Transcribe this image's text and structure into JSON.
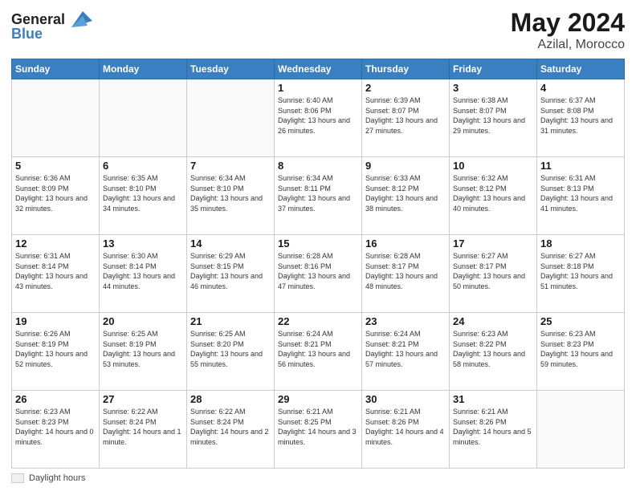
{
  "logo": {
    "part1": "General",
    "part2": "Blue"
  },
  "calendar": {
    "title": "May 2024",
    "subtitle": "Azilal, Morocco",
    "days_of_week": [
      "Sunday",
      "Monday",
      "Tuesday",
      "Wednesday",
      "Thursday",
      "Friday",
      "Saturday"
    ],
    "weeks": [
      [
        {
          "day": "",
          "info": ""
        },
        {
          "day": "",
          "info": ""
        },
        {
          "day": "",
          "info": ""
        },
        {
          "day": "1",
          "info": "Sunrise: 6:40 AM\nSunset: 8:06 PM\nDaylight: 13 hours and 26 minutes."
        },
        {
          "day": "2",
          "info": "Sunrise: 6:39 AM\nSunset: 8:07 PM\nDaylight: 13 hours and 27 minutes."
        },
        {
          "day": "3",
          "info": "Sunrise: 6:38 AM\nSunset: 8:07 PM\nDaylight: 13 hours and 29 minutes."
        },
        {
          "day": "4",
          "info": "Sunrise: 6:37 AM\nSunset: 8:08 PM\nDaylight: 13 hours and 31 minutes."
        }
      ],
      [
        {
          "day": "5",
          "info": "Sunrise: 6:36 AM\nSunset: 8:09 PM\nDaylight: 13 hours and 32 minutes."
        },
        {
          "day": "6",
          "info": "Sunrise: 6:35 AM\nSunset: 8:10 PM\nDaylight: 13 hours and 34 minutes."
        },
        {
          "day": "7",
          "info": "Sunrise: 6:34 AM\nSunset: 8:10 PM\nDaylight: 13 hours and 35 minutes."
        },
        {
          "day": "8",
          "info": "Sunrise: 6:34 AM\nSunset: 8:11 PM\nDaylight: 13 hours and 37 minutes."
        },
        {
          "day": "9",
          "info": "Sunrise: 6:33 AM\nSunset: 8:12 PM\nDaylight: 13 hours and 38 minutes."
        },
        {
          "day": "10",
          "info": "Sunrise: 6:32 AM\nSunset: 8:12 PM\nDaylight: 13 hours and 40 minutes."
        },
        {
          "day": "11",
          "info": "Sunrise: 6:31 AM\nSunset: 8:13 PM\nDaylight: 13 hours and 41 minutes."
        }
      ],
      [
        {
          "day": "12",
          "info": "Sunrise: 6:31 AM\nSunset: 8:14 PM\nDaylight: 13 hours and 43 minutes."
        },
        {
          "day": "13",
          "info": "Sunrise: 6:30 AM\nSunset: 8:14 PM\nDaylight: 13 hours and 44 minutes."
        },
        {
          "day": "14",
          "info": "Sunrise: 6:29 AM\nSunset: 8:15 PM\nDaylight: 13 hours and 46 minutes."
        },
        {
          "day": "15",
          "info": "Sunrise: 6:28 AM\nSunset: 8:16 PM\nDaylight: 13 hours and 47 minutes."
        },
        {
          "day": "16",
          "info": "Sunrise: 6:28 AM\nSunset: 8:17 PM\nDaylight: 13 hours and 48 minutes."
        },
        {
          "day": "17",
          "info": "Sunrise: 6:27 AM\nSunset: 8:17 PM\nDaylight: 13 hours and 50 minutes."
        },
        {
          "day": "18",
          "info": "Sunrise: 6:27 AM\nSunset: 8:18 PM\nDaylight: 13 hours and 51 minutes."
        }
      ],
      [
        {
          "day": "19",
          "info": "Sunrise: 6:26 AM\nSunset: 8:19 PM\nDaylight: 13 hours and 52 minutes."
        },
        {
          "day": "20",
          "info": "Sunrise: 6:25 AM\nSunset: 8:19 PM\nDaylight: 13 hours and 53 minutes."
        },
        {
          "day": "21",
          "info": "Sunrise: 6:25 AM\nSunset: 8:20 PM\nDaylight: 13 hours and 55 minutes."
        },
        {
          "day": "22",
          "info": "Sunrise: 6:24 AM\nSunset: 8:21 PM\nDaylight: 13 hours and 56 minutes."
        },
        {
          "day": "23",
          "info": "Sunrise: 6:24 AM\nSunset: 8:21 PM\nDaylight: 13 hours and 57 minutes."
        },
        {
          "day": "24",
          "info": "Sunrise: 6:23 AM\nSunset: 8:22 PM\nDaylight: 13 hours and 58 minutes."
        },
        {
          "day": "25",
          "info": "Sunrise: 6:23 AM\nSunset: 8:23 PM\nDaylight: 13 hours and 59 minutes."
        }
      ],
      [
        {
          "day": "26",
          "info": "Sunrise: 6:23 AM\nSunset: 8:23 PM\nDaylight: 14 hours and 0 minutes."
        },
        {
          "day": "27",
          "info": "Sunrise: 6:22 AM\nSunset: 8:24 PM\nDaylight: 14 hours and 1 minute."
        },
        {
          "day": "28",
          "info": "Sunrise: 6:22 AM\nSunset: 8:24 PM\nDaylight: 14 hours and 2 minutes."
        },
        {
          "day": "29",
          "info": "Sunrise: 6:21 AM\nSunset: 8:25 PM\nDaylight: 14 hours and 3 minutes."
        },
        {
          "day": "30",
          "info": "Sunrise: 6:21 AM\nSunset: 8:26 PM\nDaylight: 14 hours and 4 minutes."
        },
        {
          "day": "31",
          "info": "Sunrise: 6:21 AM\nSunset: 8:26 PM\nDaylight: 14 hours and 5 minutes."
        },
        {
          "day": "",
          "info": ""
        }
      ]
    ]
  },
  "legend": {
    "label": "Daylight hours"
  }
}
